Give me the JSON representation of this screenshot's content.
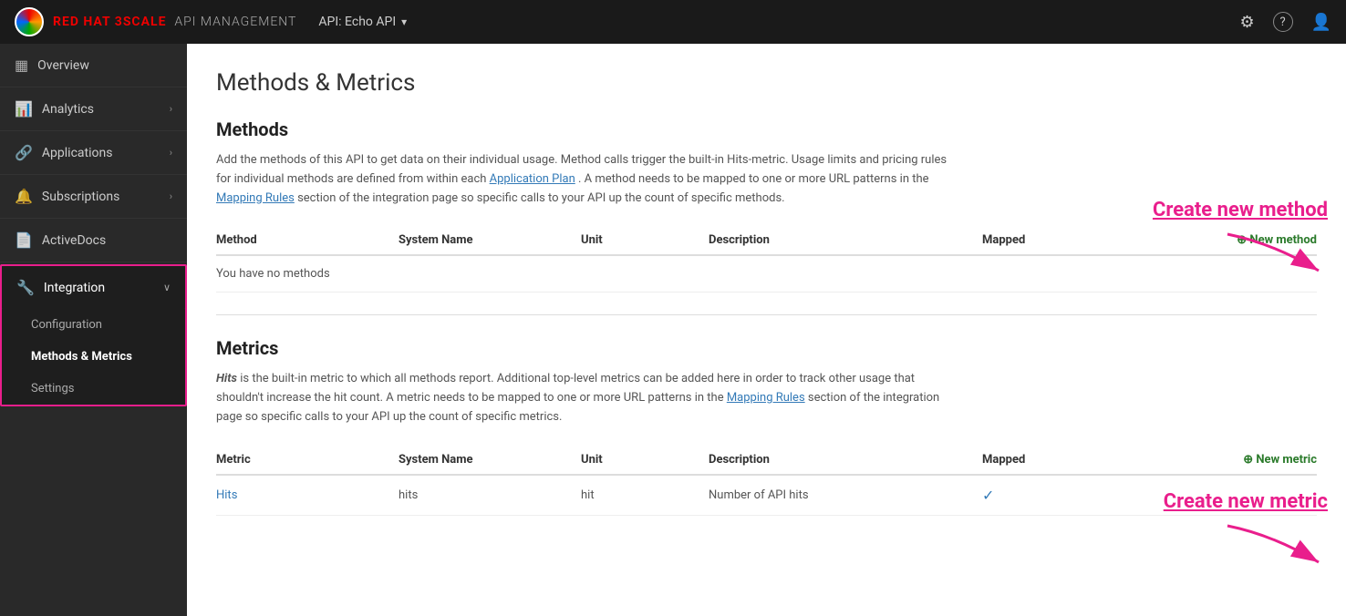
{
  "topbar": {
    "logo_text": "RED HAT 3SCALE",
    "logo_sub": "API MANAGEMENT",
    "api_label": "API: Echo API",
    "gear_icon": "⚙",
    "help_icon": "?",
    "user_icon": "👤"
  },
  "sidebar": {
    "items": [
      {
        "id": "overview",
        "label": "Overview",
        "icon": "▦",
        "has_arrow": false
      },
      {
        "id": "analytics",
        "label": "Analytics",
        "icon": "📊",
        "has_arrow": true
      },
      {
        "id": "applications",
        "label": "Applications",
        "icon": "🔗",
        "has_arrow": true
      },
      {
        "id": "subscriptions",
        "label": "Subscriptions",
        "icon": "🔔",
        "has_arrow": true
      },
      {
        "id": "activedocs",
        "label": "ActiveDocs",
        "icon": "📄",
        "has_arrow": false
      },
      {
        "id": "integration",
        "label": "Integration",
        "icon": "🔧",
        "has_arrow": true,
        "active": true
      }
    ],
    "integration_sub_items": [
      {
        "id": "configuration",
        "label": "Configuration",
        "active": false
      },
      {
        "id": "methods-metrics",
        "label": "Methods & Metrics",
        "active": true
      },
      {
        "id": "settings",
        "label": "Settings",
        "active": false
      }
    ]
  },
  "main": {
    "page_title": "Methods & Metrics",
    "methods_section": {
      "title": "Methods",
      "description": "Add the methods of this API to get data on their individual usage. Method calls trigger the built-in Hits-metric. Usage limits and pricing rules for individual methods are defined from within each",
      "link1_text": "Application Plan",
      "description2": ". A method needs to be mapped to one or more URL patterns in the",
      "link2_text": "Mapping Rules",
      "description3": "section of the integration page so specific calls to your API up the count of specific methods.",
      "table_headers": [
        "Method",
        "System Name",
        "Unit",
        "Description",
        "Mapped"
      ],
      "new_method_label": "⊕ New method",
      "no_methods_text": "You have no methods",
      "rows": []
    },
    "metrics_section": {
      "title": "Metrics",
      "description1": "Hits",
      "description2": " is the built-in metric to which all methods report. Additional top-level metrics can be added here in order to track other usage that shouldn't increase the hit count. A metric needs to be mapped to one or more URL patterns in the",
      "link_text": "Mapping Rules",
      "description3": "section of the integration page so specific calls to your API up the count of specific metrics.",
      "table_headers": [
        "Metric",
        "System Name",
        "Unit",
        "Description",
        "Mapped"
      ],
      "new_metric_label": "⊕ New metric",
      "rows": [
        {
          "metric": "Hits",
          "system_name": "hits",
          "unit": "hit",
          "description": "Number of API hits",
          "mapped": true
        }
      ]
    },
    "create_method_annotation": "Create new method",
    "create_metric_annotation": "Create new metric"
  }
}
